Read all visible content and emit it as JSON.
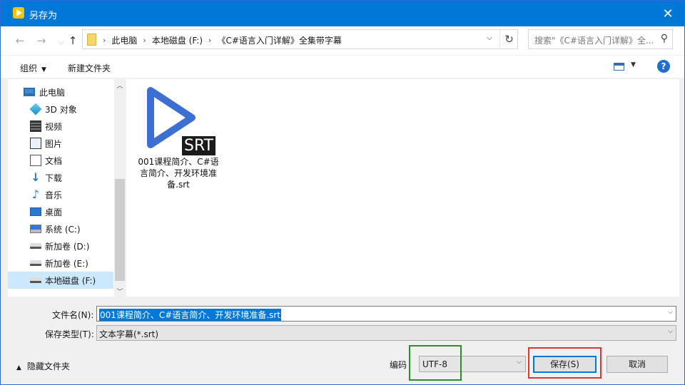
{
  "window": {
    "title": "另存为",
    "close_glyph": "✕"
  },
  "nav": {
    "back_glyph": "←",
    "forward_glyph": "→",
    "up_glyph": "↑",
    "breadcrumbs": [
      "此电脑",
      "本地磁盘 (F:)",
      "《C#语言入门详解》全集带字幕"
    ],
    "separator": "›",
    "dropdown_glyph": "⌵",
    "refresh_glyph": "↻",
    "search_placeholder": "搜索\"《C#语言入门详解》全...",
    "search_glyph": "⚲"
  },
  "toolbar": {
    "organize": "组织",
    "new_folder": "新建文件夹",
    "caret": "▼",
    "help": "?"
  },
  "sidebar": {
    "items": [
      {
        "label": "此电脑",
        "icon": "pc-icon"
      },
      {
        "label": "3D 对象",
        "icon": "3d-objects-icon"
      },
      {
        "label": "视频",
        "icon": "video-icon"
      },
      {
        "label": "图片",
        "icon": "pictures-icon"
      },
      {
        "label": "文档",
        "icon": "documents-icon"
      },
      {
        "label": "下载",
        "icon": "downloads-icon"
      },
      {
        "label": "音乐",
        "icon": "music-icon"
      },
      {
        "label": "桌面",
        "icon": "desktop-icon"
      },
      {
        "label": "系统 (C:)",
        "icon": "system-drive-icon"
      },
      {
        "label": "新加卷 (D:)",
        "icon": "drive-icon"
      },
      {
        "label": "新加卷 (E:)",
        "icon": "drive-icon"
      },
      {
        "label": "本地磁盘 (F:)",
        "icon": "drive-icon",
        "selected": true
      }
    ],
    "scroll_up": "︿",
    "scroll_down": "﹀",
    "glyphs": {
      "downloads": "↓",
      "music": "♪"
    }
  },
  "content": {
    "file": {
      "name": "001课程简介、C#语言简介、开发环境准备.srt",
      "badge": "SRT",
      "icon": "play-file-icon",
      "accent": "#3b6fd1"
    }
  },
  "form": {
    "filename_label": "文件名(N):",
    "filename_value": "001课程简介、C#语言简介、开发环境准备.srt",
    "filetype_label": "保存类型(T):",
    "filetype_value": "文本字幕(*.srt)",
    "arrow": "⌵"
  },
  "footer": {
    "hide_folders": "隐藏文件夹",
    "hide_caret": "▲",
    "encoding_label": "编码",
    "encoding_value": "UTF-8",
    "save": "保存(S)",
    "cancel": "取消"
  },
  "colors": {
    "title_bar": "#0078d7",
    "selection": "#cce8ff",
    "encoding_highlight": "#2f8a2f",
    "save_highlight": "#e23333"
  }
}
